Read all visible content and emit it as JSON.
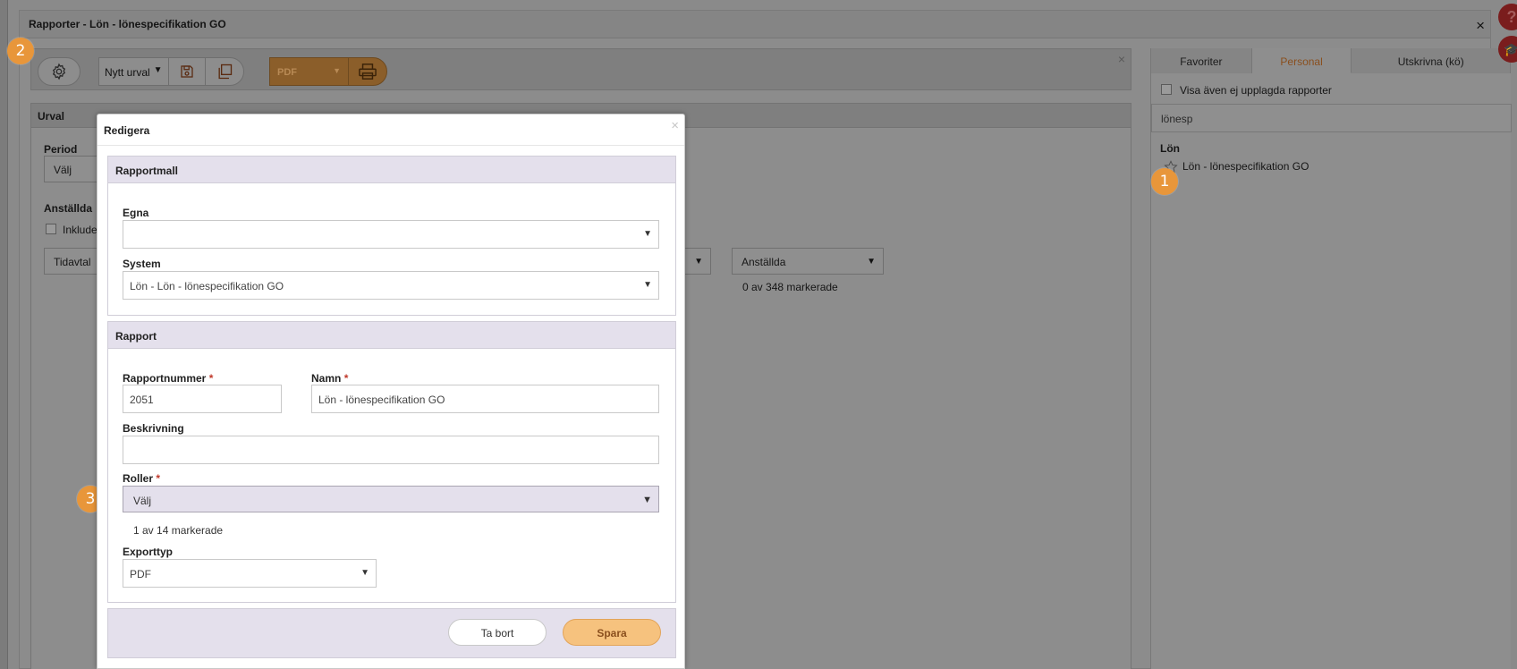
{
  "window": {
    "title": "Rapporter - Lön - lönespecifikation GO",
    "close_label": "×"
  },
  "toolbar": {
    "selection_label": "Nytt urval",
    "export_label": "PDF",
    "close_label": "×"
  },
  "urval": {
    "title": "Urval",
    "period_label": "Period",
    "period_value": "Välj",
    "employees_label": "Anställda",
    "include_label": "Inkluder",
    "agreement_value": "Tidavtal",
    "employees_dropdown": "Anställda",
    "employees_count": "0 av 348 markerade"
  },
  "right_panel": {
    "tabs": [
      {
        "label": "Favoriter",
        "active": false
      },
      {
        "label": "Personal",
        "active": true
      },
      {
        "label": "Utskrivna (kö)",
        "active": false
      }
    ],
    "show_unposted_label": "Visa även ej upplagda rapporter",
    "search_value": "lönesp",
    "group_label": "Lön",
    "report_item": "Lön - lönespecifikation GO"
  },
  "badges": {
    "one": "1",
    "two": "2",
    "three": "3"
  },
  "modal": {
    "title": "Redigera",
    "close_label": "×",
    "template_section": {
      "title": "Rapportmall",
      "own_label": "Egna",
      "own_value": "",
      "system_label": "System",
      "system_value": "Lön - Lön - lönespecifikation GO"
    },
    "report_section": {
      "title": "Rapport",
      "number_label": "Rapportnummer",
      "number_value": "2051",
      "name_label": "Namn",
      "name_value": "Lön - lönespecifikation GO",
      "description_label": "Beskrivning",
      "description_value": "",
      "roles_label": "Roller",
      "roles_value": "Välj",
      "roles_count": "1 av 14 markerade",
      "export_label": "Exporttyp",
      "export_value": "PDF",
      "required_mark": "*"
    },
    "buttons": {
      "delete": "Ta bort",
      "save": "Spara"
    }
  },
  "colors": {
    "accent": "#e8963a",
    "active_tab": "#8a4f1e",
    "section_header": "#e4e0ec",
    "save_button": "#f6c27e"
  }
}
